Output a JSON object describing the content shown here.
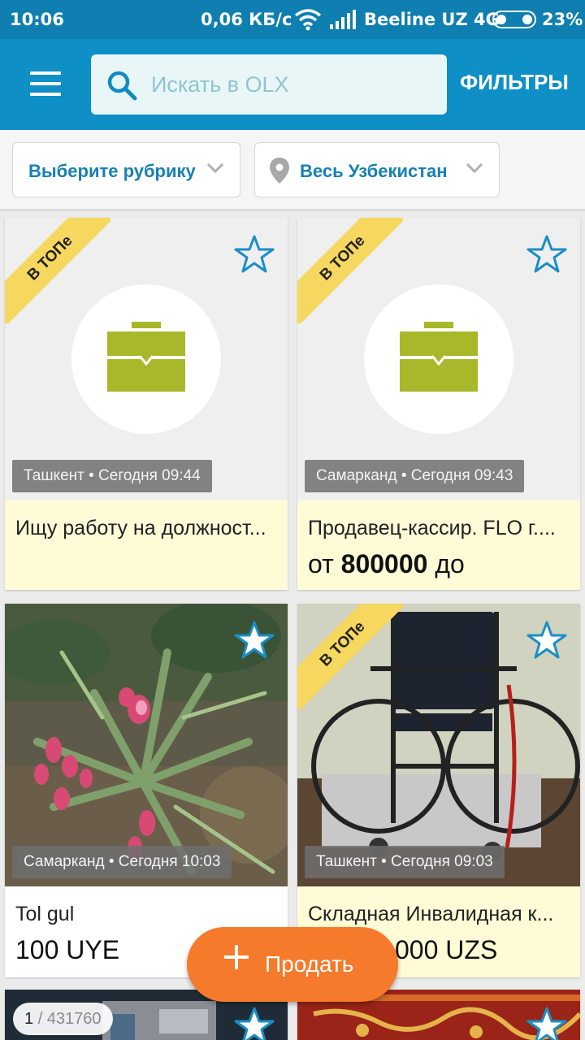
{
  "status_bar": {
    "time": "10:06",
    "speed": "0,06 КБ/с",
    "carrier": "Beeline UZ 4G",
    "battery": "23%"
  },
  "header": {
    "search_placeholder": "Искать в OLX",
    "filters_label": "ФИЛЬТРЫ"
  },
  "filter_bar": {
    "category": "Выберите рубрику",
    "region": "Весь Узбекистан"
  },
  "listings": [
    {
      "badge": "В ТОПе",
      "location": "Ташкент • Сегодня 09:44",
      "title": "Ищу работу на должност...",
      "price": ""
    },
    {
      "badge": "В ТОПе",
      "location": "Самарканд • Сегодня 09:43",
      "title": "Продавец-кассир. FLO г....",
      "price_prefix": "от",
      "price_value": "800000",
      "price_suffix": "до"
    },
    {
      "location": "Самарканд • Сегодня 10:03",
      "title": "Tol gul",
      "price": "100 UYE"
    },
    {
      "badge": "В ТОПе",
      "location": "Ташкент • Сегодня 09:03",
      "title": "Складная Инвалидная к...",
      "price": "000 UZS"
    }
  ],
  "gallery_counter": {
    "current": "1",
    "total": "/ 431760"
  },
  "sell_button": {
    "label": "Продать"
  },
  "colors": {
    "status_bar": "#0e7fb0",
    "app_bar": "#0e8fc6",
    "accent_blue": "#1780b3",
    "ribbon": "#f6d860",
    "info_bg": "#fffbd7",
    "sell_orange": "#f57a2b",
    "briefcase": "#a9b82b"
  }
}
